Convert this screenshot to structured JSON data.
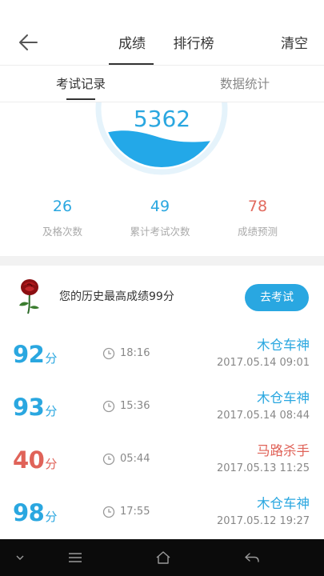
{
  "header": {
    "tabs": [
      {
        "label": "成绩"
      },
      {
        "label": "排行榜"
      }
    ],
    "clear_label": "清空"
  },
  "subtabs": [
    {
      "label": "考试记录"
    },
    {
      "label": "数据统计"
    }
  ],
  "gauge": {
    "value": "5362"
  },
  "stats": [
    {
      "value": "26",
      "label": "及格次数",
      "color": "#2aa7e0"
    },
    {
      "value": "49",
      "label": "累计考试次数",
      "color": "#2aa7e0"
    },
    {
      "value": "78",
      "label": "成绩预测",
      "color": "#e26a5e"
    }
  ],
  "best": {
    "text": "您的历史最高成绩99分",
    "button_label": "去考试"
  },
  "records": [
    {
      "score": "92",
      "unit": "分",
      "duration": "18:16",
      "title": "木仓车神",
      "date": "2017.05.14  09:01",
      "color": "blue"
    },
    {
      "score": "93",
      "unit": "分",
      "duration": "15:36",
      "title": "木仓车神",
      "date": "2017.05.14  08:44",
      "color": "blue"
    },
    {
      "score": "40",
      "unit": "分",
      "duration": "05:44",
      "title": "马路杀手",
      "date": "2017.05.13  11:25",
      "color": "red"
    },
    {
      "score": "98",
      "unit": "分",
      "duration": "17:55",
      "title": "木仓车神",
      "date": "2017.05.12  19:27",
      "color": "blue"
    }
  ],
  "colors": {
    "accent": "#29a7e1",
    "danger": "#e06359",
    "navbar": "#0b0b0b"
  },
  "icons": {
    "back": "arrow-left-icon",
    "rose": "rose-icon",
    "clock": "clock-icon",
    "nav": [
      "chevron-down-icon",
      "menu-icon",
      "home-icon",
      "back-icon"
    ]
  }
}
